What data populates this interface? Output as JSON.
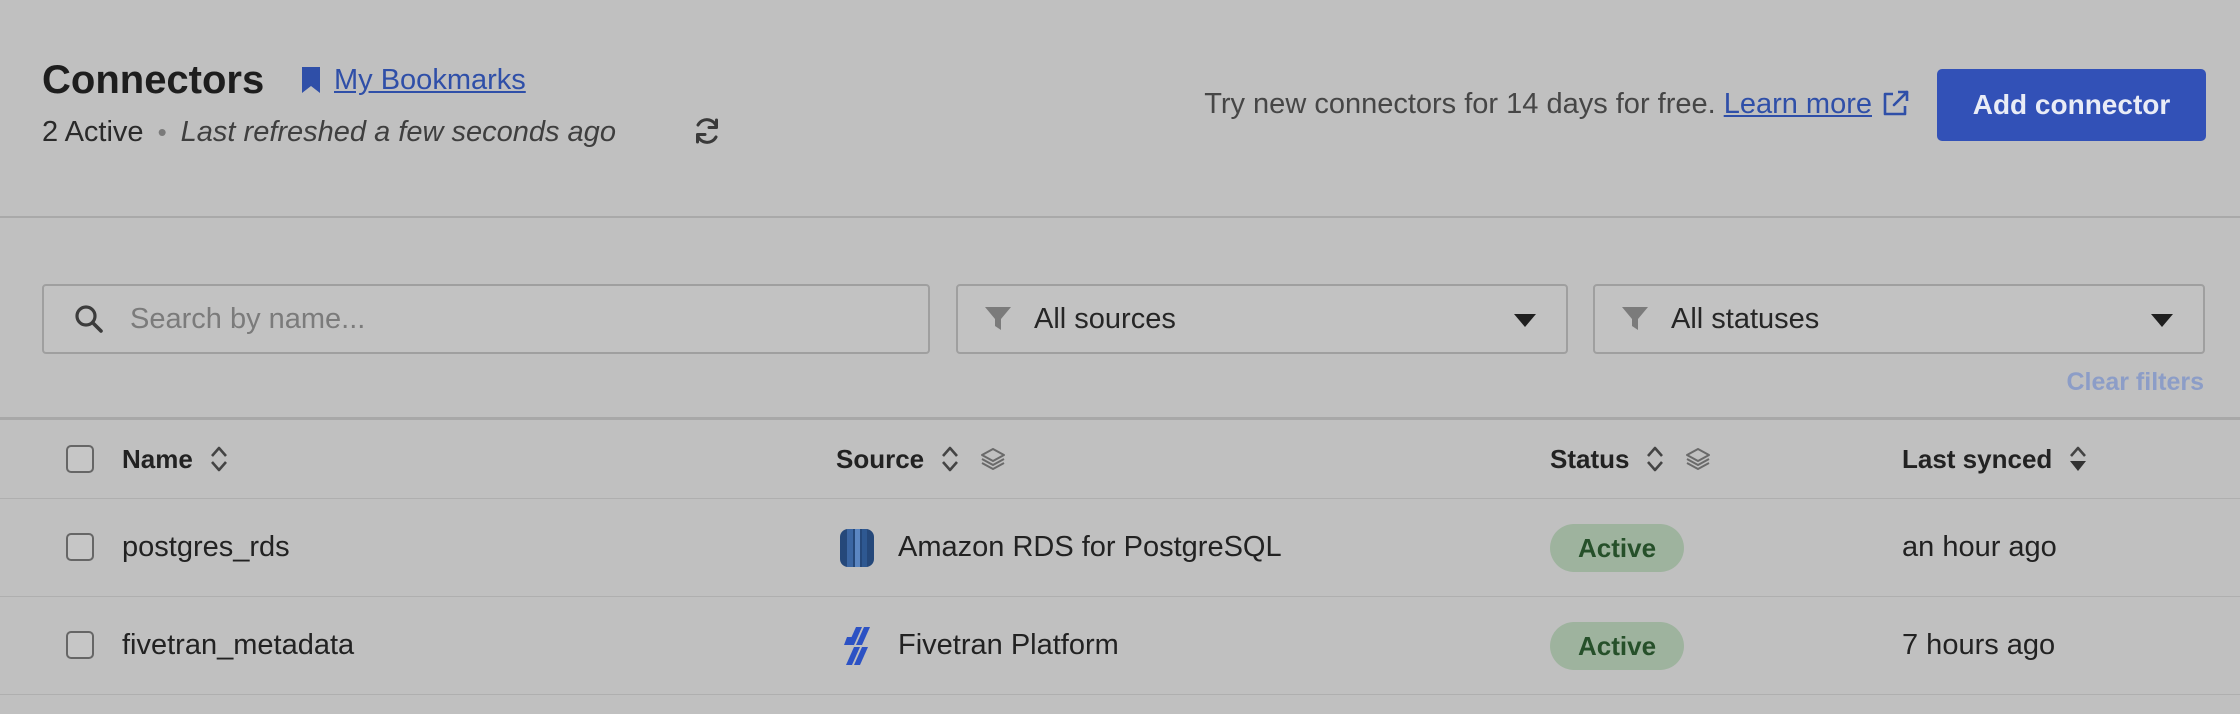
{
  "header": {
    "title": "Connectors",
    "bookmark_label": "My Bookmarks",
    "active_count": "2 Active",
    "separator": "•",
    "refreshed": "Last refreshed a few seconds ago",
    "promo_text": "Try new connectors for 14 days for free.",
    "promo_link": "Learn more",
    "add_button": "Add connector"
  },
  "filters": {
    "search_placeholder": "Search by name...",
    "search_value": "",
    "sources_value": "All sources",
    "statuses_value": "All statuses",
    "clear_label": "Clear filters"
  },
  "table": {
    "columns": {
      "name": "Name",
      "source": "Source",
      "status": "Status",
      "last_synced": "Last synced"
    },
    "rows": [
      {
        "name": "postgres_rds",
        "source": "Amazon RDS for PostgreSQL",
        "source_icon": "amazon-rds-logo",
        "status": "Active",
        "last_synced": "an hour ago"
      },
      {
        "name": "fivetran_metadata",
        "source": "Fivetran Platform",
        "source_icon": "fivetran-logo",
        "status": "Active",
        "last_synced": "7 hours ago"
      }
    ]
  },
  "colors": {
    "accent": "#3251b7",
    "link": "#2f4fa8",
    "status_active_bg": "#9eb39e",
    "status_active_text": "#26502a",
    "background": "#c0c0c0"
  }
}
